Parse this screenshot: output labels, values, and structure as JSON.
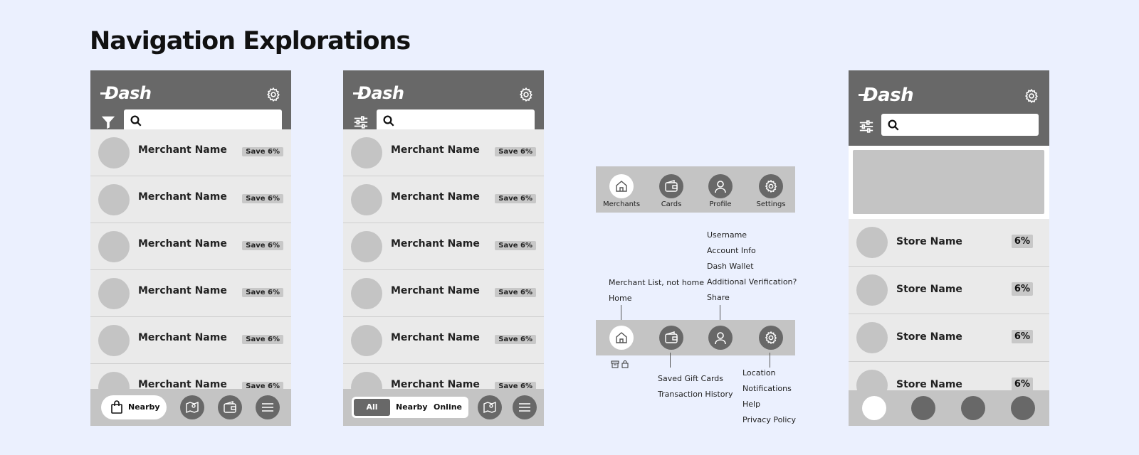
{
  "page": {
    "title": "Navigation Explorations"
  },
  "brand": {
    "logo_text": "Dash"
  },
  "merchant_list": {
    "rows": [
      {
        "name": "Merchant Name",
        "badge": "Save 6%"
      },
      {
        "name": "Merchant Name",
        "badge": "Save 6%"
      },
      {
        "name": "Merchant Name",
        "badge": "Save 6%"
      },
      {
        "name": "Merchant Name",
        "badge": "Save 6%"
      },
      {
        "name": "Merchant Name",
        "badge": "Save 6%"
      },
      {
        "name": "Merchant Name",
        "badge": "Save 6%"
      }
    ]
  },
  "phone1": {
    "nearby_label": "Nearby"
  },
  "phone2": {
    "segments": [
      "All",
      "Nearby",
      "Online"
    ]
  },
  "nav_top": {
    "items": [
      {
        "label": "Merchants",
        "icon": "home-icon"
      },
      {
        "label": "Cards",
        "icon": "wallet-icon"
      },
      {
        "label": "Profile",
        "icon": "person-icon"
      },
      {
        "label": "Settings",
        "icon": "gear-icon"
      }
    ]
  },
  "nav_notes": {
    "home": [
      "Merchant List, not home",
      "Home"
    ],
    "profile": [
      "Username",
      "Account Info",
      "Dash Wallet",
      "Additional Verification?",
      "Share"
    ],
    "cards": [
      "Saved Gift Cards",
      "Transaction History"
    ],
    "settings": [
      "Location",
      "Notifications",
      "Help",
      "Privacy Policy"
    ]
  },
  "store_list": {
    "rows": [
      {
        "name": "Store Name",
        "badge": "6%"
      },
      {
        "name": "Store Name",
        "badge": "6%"
      },
      {
        "name": "Store Name",
        "badge": "6%"
      },
      {
        "name": "Store Name",
        "badge": "6%"
      }
    ]
  },
  "colors": {
    "background": "#ebf0fe",
    "header": "#686868",
    "list_bg": "#eaeaea",
    "placeholder": "#c4c4c4"
  }
}
